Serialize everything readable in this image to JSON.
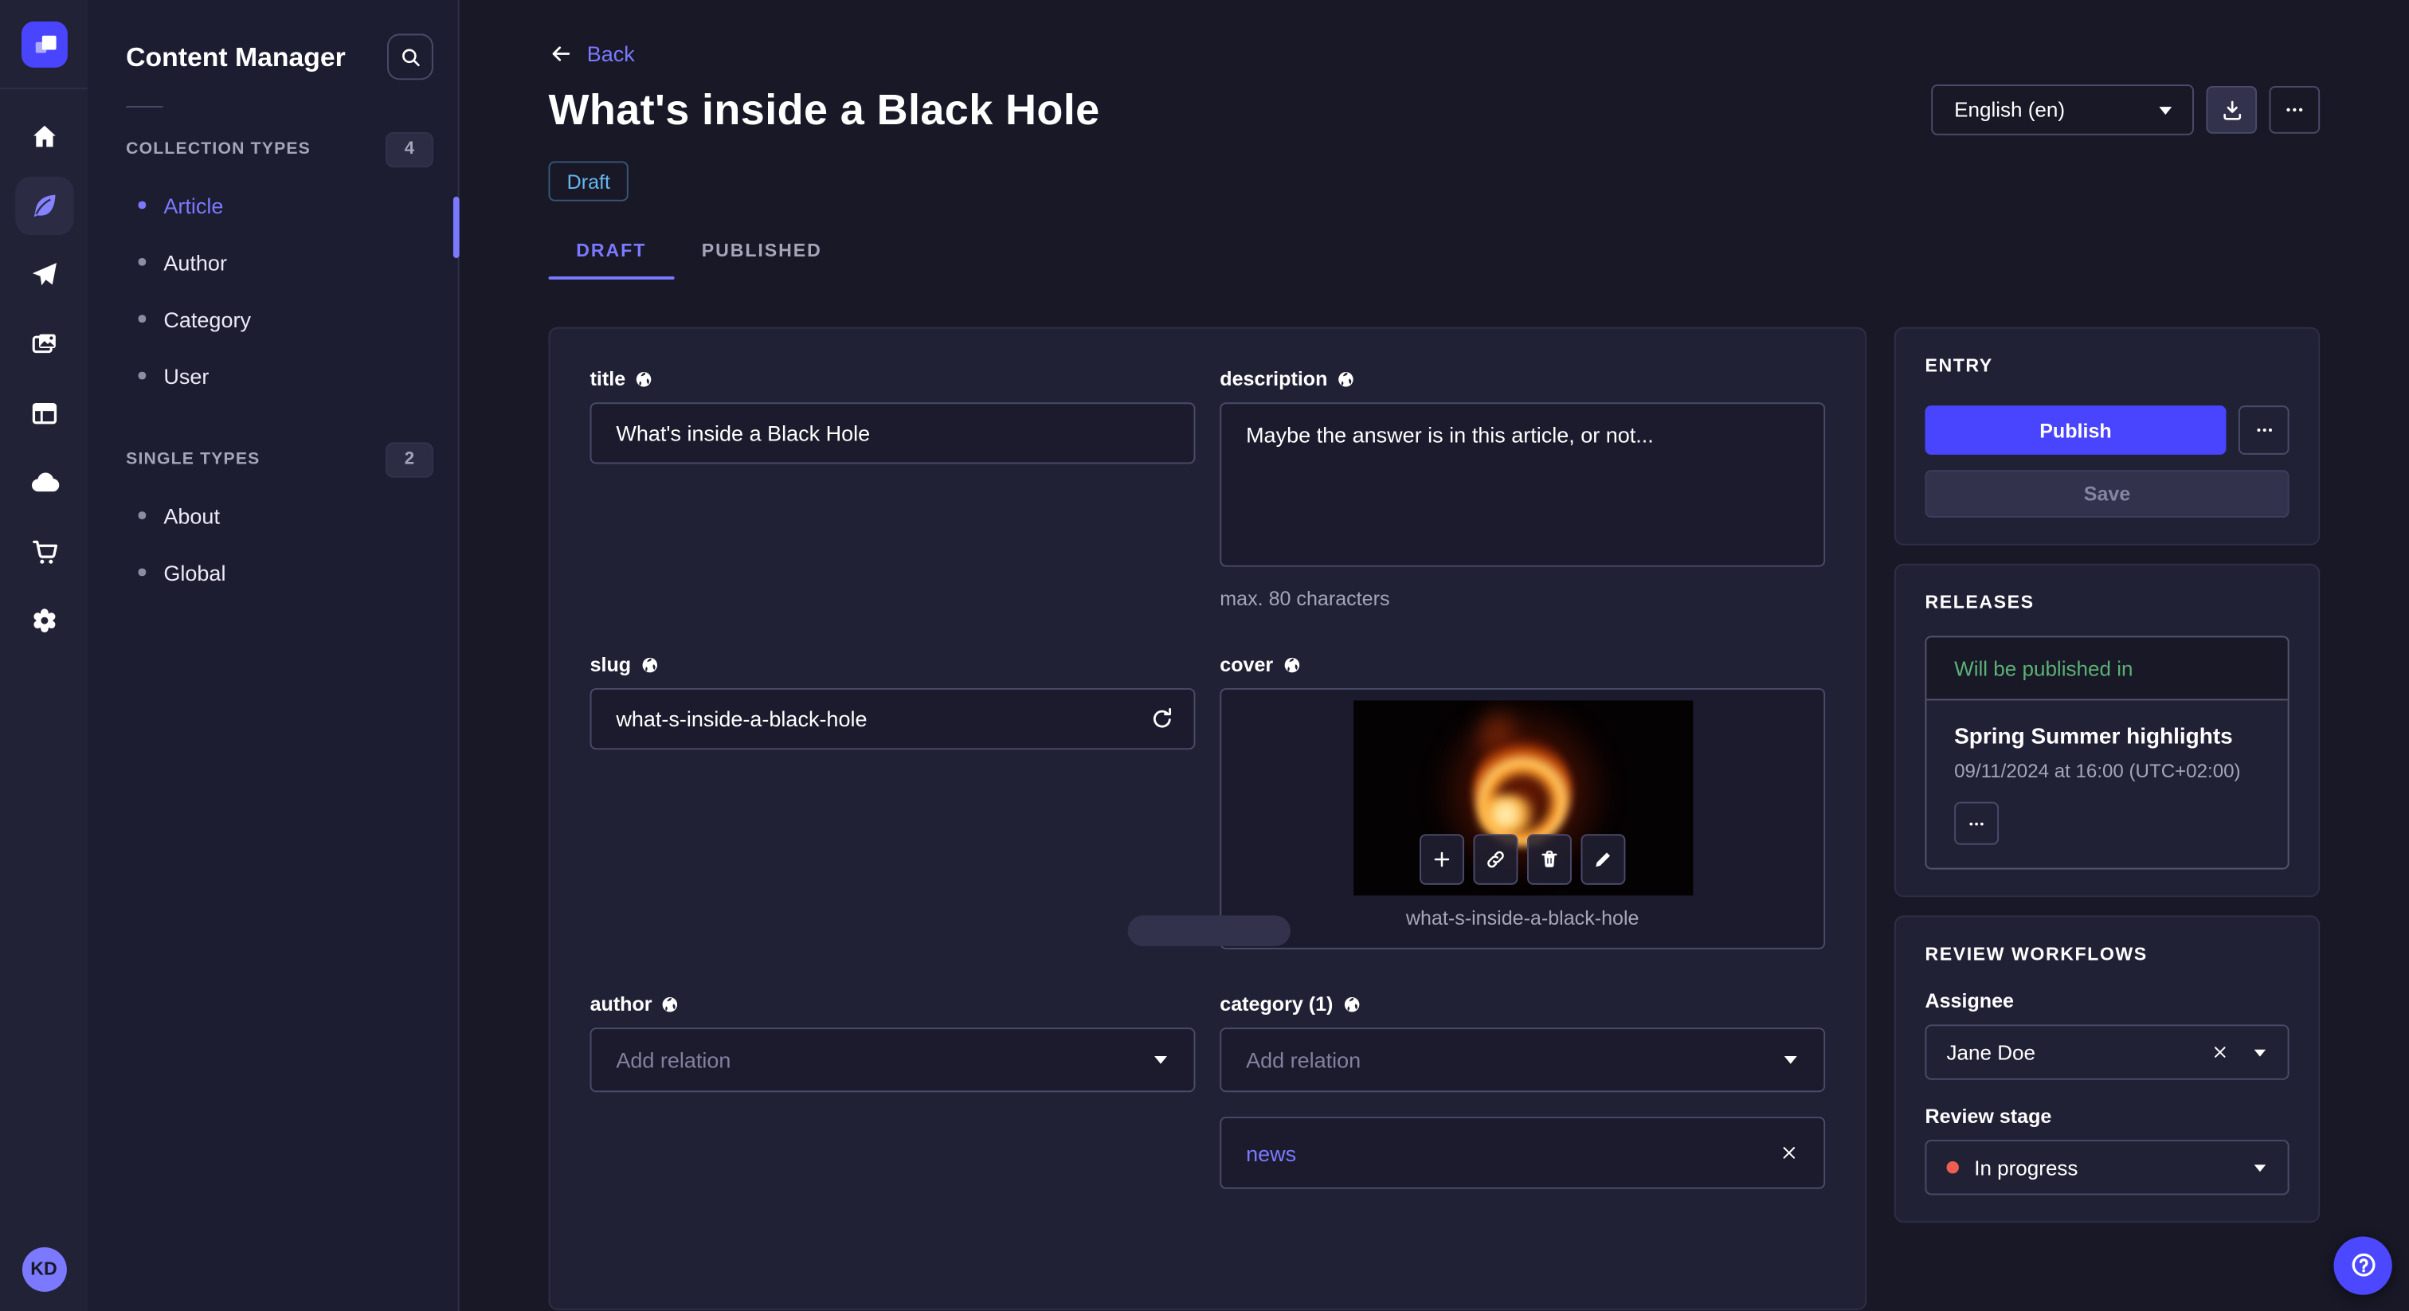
{
  "colors": {
    "accent": "#4945ff",
    "accent_light": "#7b79ff",
    "draft_blue": "#66b7f1",
    "success_green": "#5cb176",
    "stage_red": "#ee5e52",
    "background": "#181826",
    "panel": "#212136"
  },
  "rail": {
    "avatar_initials": "KD"
  },
  "sidebar": {
    "title": "Content Manager",
    "sections": [
      {
        "label": "COLLECTION TYPES",
        "count": "4",
        "items": [
          {
            "label": "Article"
          },
          {
            "label": "Author"
          },
          {
            "label": "Category"
          },
          {
            "label": "User"
          }
        ]
      },
      {
        "label": "SINGLE TYPES",
        "count": "2",
        "items": [
          {
            "label": "About"
          },
          {
            "label": "Global"
          }
        ]
      }
    ]
  },
  "header": {
    "back_label": "Back",
    "title": "What's inside a Black Hole",
    "status_badge": "Draft",
    "tabs": [
      {
        "label": "DRAFT"
      },
      {
        "label": "PUBLISHED"
      }
    ],
    "locale_select": "English (en)"
  },
  "form": {
    "title": {
      "label": "title",
      "value": "What's inside a Black Hole"
    },
    "description": {
      "label": "description",
      "value": "Maybe the answer is in this article, or not...",
      "hint": "max. 80 characters"
    },
    "slug": {
      "label": "slug",
      "value": "what-s-inside-a-black-hole"
    },
    "cover": {
      "label": "cover",
      "filename": "what-s-inside-a-black-hole"
    },
    "author": {
      "label": "author",
      "placeholder": "Add relation"
    },
    "category": {
      "label": "category (1)",
      "placeholder": "Add relation",
      "relation": "news"
    }
  },
  "entry_panel": {
    "title": "ENTRY",
    "publish_label": "Publish",
    "save_label": "Save"
  },
  "releases_panel": {
    "title": "RELEASES",
    "card_header": "Will be published in",
    "release_name": "Spring Summer highlights",
    "release_date": "09/11/2024 at 16:00 (UTC+02:00)"
  },
  "review_panel": {
    "title": "REVIEW WORKFLOWS",
    "assignee_label": "Assignee",
    "assignee_value": "Jane Doe",
    "stage_label": "Review stage",
    "stage_value": "In progress"
  }
}
